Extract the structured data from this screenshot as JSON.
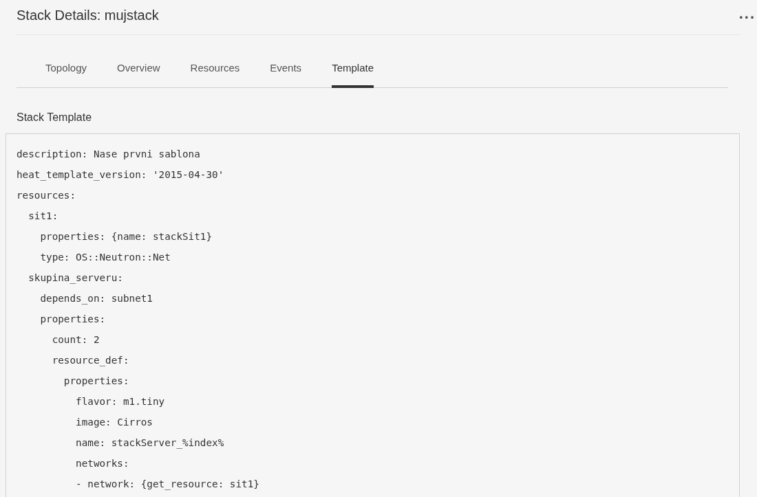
{
  "header": {
    "title": "Stack Details: mujstack",
    "more_menu": "..."
  },
  "tabs": [
    {
      "label": "Topology",
      "selected": false
    },
    {
      "label": "Overview",
      "selected": false
    },
    {
      "label": "Resources",
      "selected": false
    },
    {
      "label": "Events",
      "selected": false
    },
    {
      "label": "Template",
      "selected": true
    }
  ],
  "section": {
    "title": "Stack Template",
    "lines": [
      "description: Nase prvni sablona",
      "heat_template_version: '2015-04-30'",
      "resources:",
      "  sit1:",
      "    properties: {name: stackSit1}",
      "    type: OS::Neutron::Net",
      "  skupina_serveru:",
      "    depends_on: subnet1",
      "    properties:",
      "      count: 2",
      "      resource_def:",
      "        properties:",
      "          flavor: m1.tiny",
      "          image: Cirros",
      "          name: stackServer_%index%",
      "          networks:",
      "          - network: {get_resource: sit1}"
    ]
  }
}
